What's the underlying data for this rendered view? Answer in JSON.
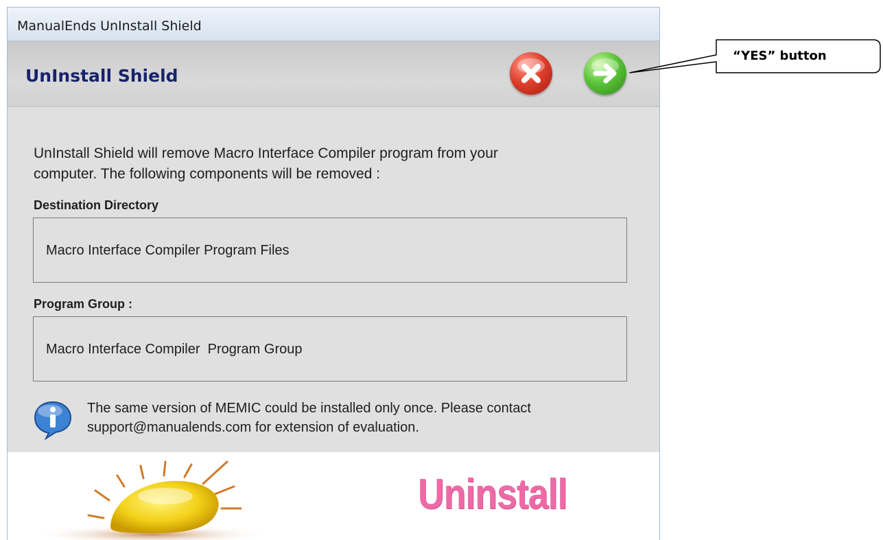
{
  "window": {
    "title": "ManualEnds UnInstall Shield"
  },
  "header": {
    "title": "UnInstall Shield",
    "cancel_icon": "close-icon",
    "yes_icon": "arrow-right-icon"
  },
  "body": {
    "intro": "  UnInstall Shield will remove Macro Interface Compiler program from your\ncomputer.  The following components will be removed :",
    "destination_label": "Destination Directory",
    "destination_value": "Macro Interface Compiler Program Files",
    "program_group_label": "Program Group :",
    "program_group_value": "Macro Interface Compiler  Program Group",
    "info_text": "The same version of MEMIC could be installed only once.  Please contact\nsupport@manualends.com for extension of evaluation.",
    "info_icon": "info-icon"
  },
  "banner": {
    "text": "Uninstall"
  },
  "annotation": {
    "label": "“YES” button"
  },
  "colors": {
    "header_title": "#17236b",
    "banner_text": "#ee6aa6",
    "cancel_red": "#e0402e",
    "yes_green": "#5cc43a"
  }
}
